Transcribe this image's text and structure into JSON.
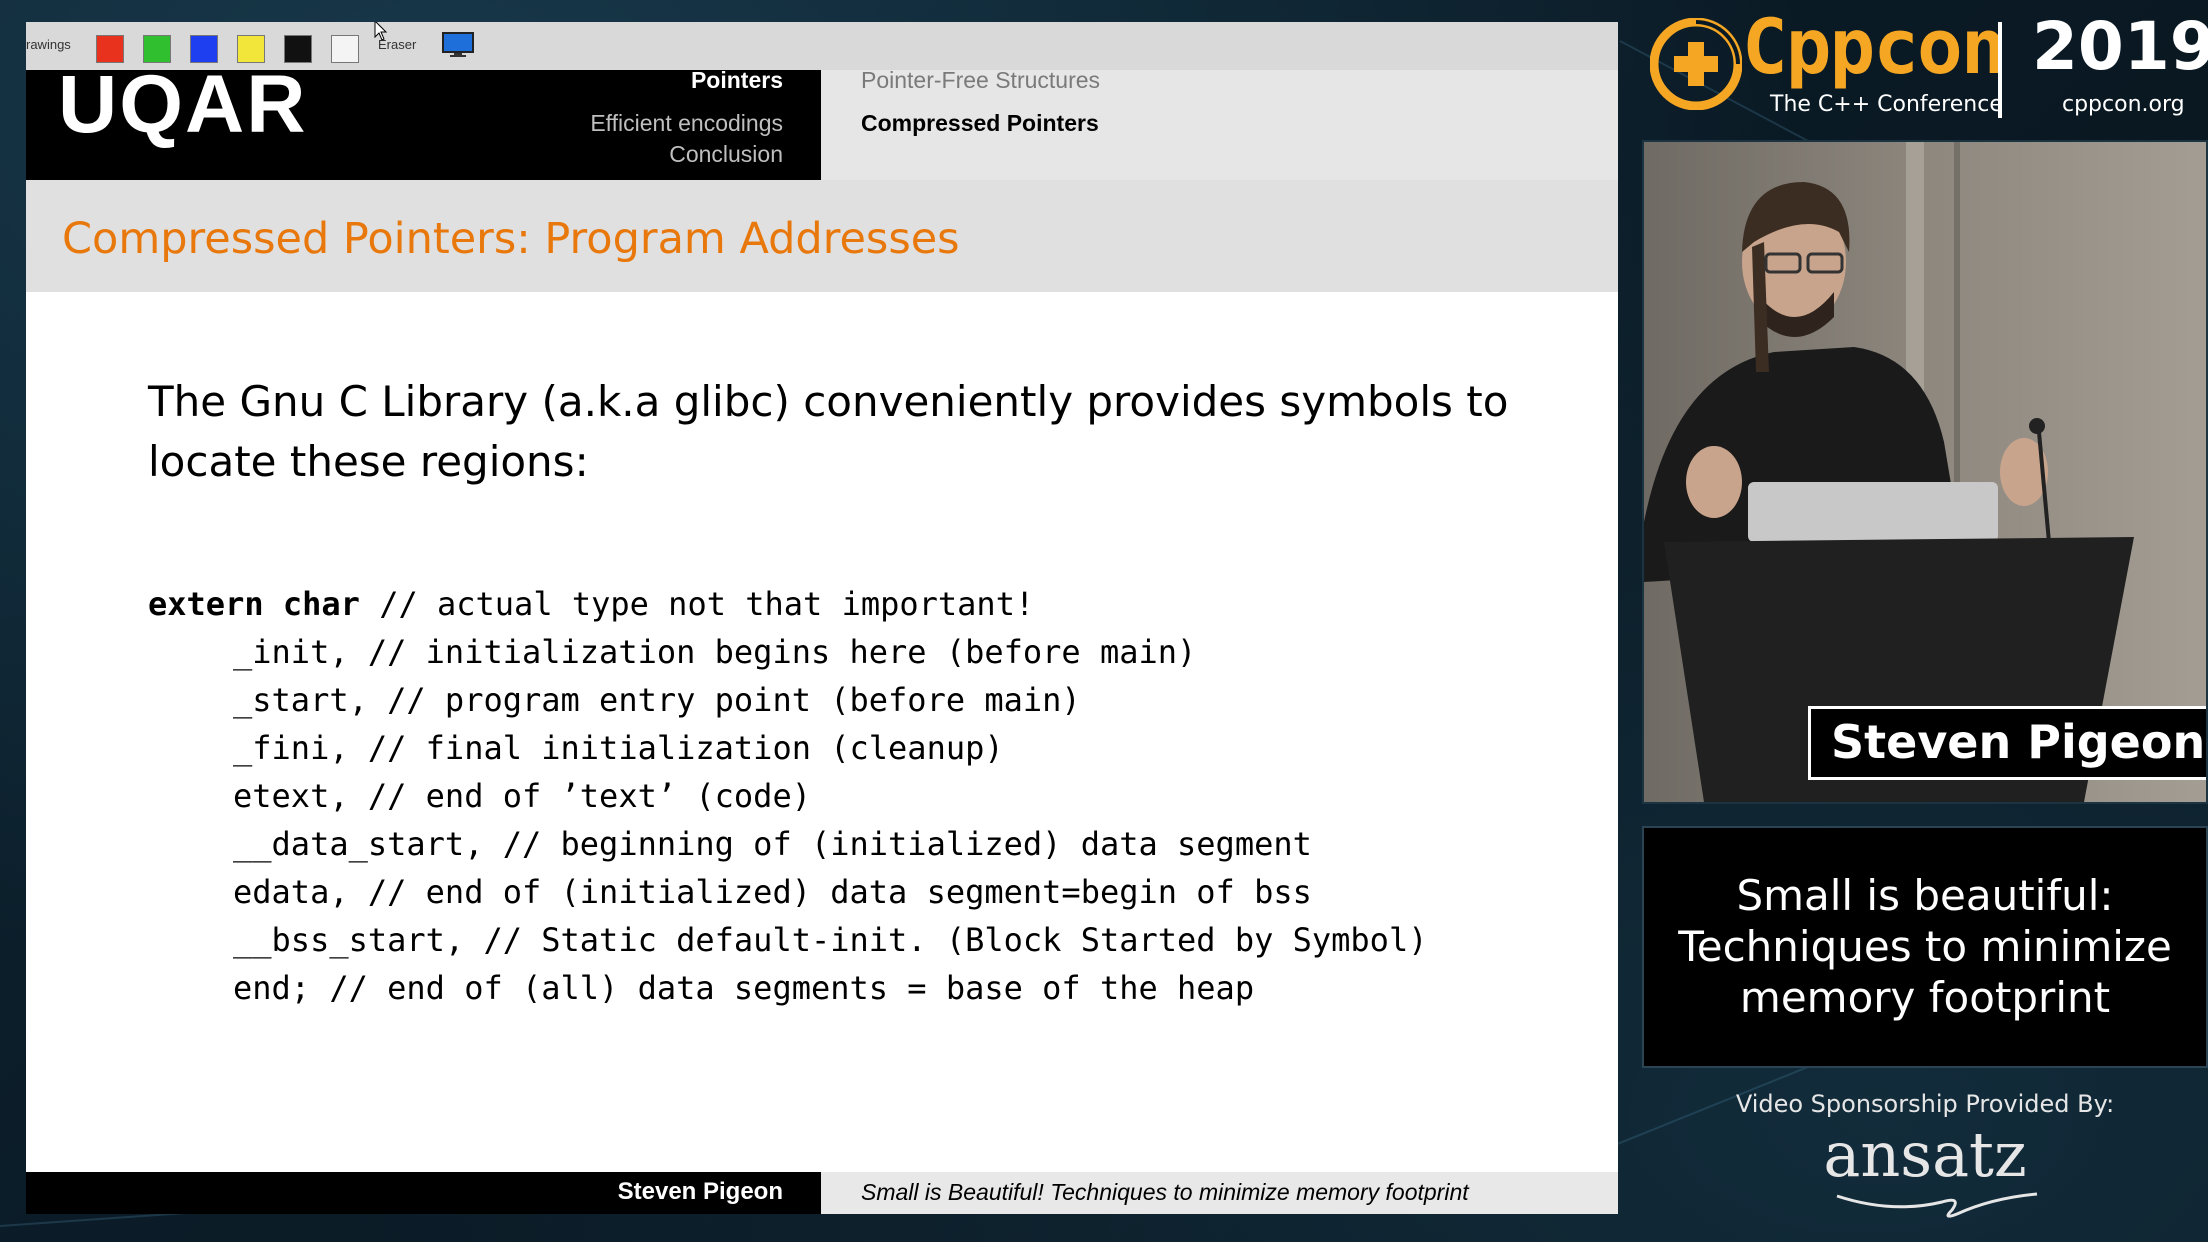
{
  "toolbar": {
    "drawings_label": "rawings",
    "eraser_label": "Eraser",
    "swatches": [
      "#e8321e",
      "#2fbf2f",
      "#1d3ff0",
      "#f2e63a",
      "#111111",
      "#f4f4f4"
    ]
  },
  "slide": {
    "logo": "UQAR",
    "nav_sections": [
      "Pointers",
      "Efficient encodings",
      "Conclusion"
    ],
    "nav_subsections": [
      "Pointer-Free Structures",
      "Compressed Pointers"
    ],
    "frame_title": "Compressed Pointers: Program Addresses",
    "intro": "The Gnu C Library (a.k.a glibc) conveniently provides symbols to locate these regions:",
    "code": {
      "keyword": "extern char",
      "first_comment": " // actual type not that important!",
      "lines": [
        "_init, // initialization begins here (before main)",
        "_start, // program entry point (before main)",
        "_fini, // final initialization (cleanup)",
        "etext, // end of ’text’ (code)",
        "__data_start, // beginning of (initialized) data segment",
        "edata, // end of (initialized) data segment=begin of bss",
        "__bss_start, // Static default-init. (Block Started by Symbol)",
        "end; // end of (all) data segments = base of the heap"
      ]
    },
    "footer_author": "Steven Pigeon",
    "footer_title": "Small is Beautiful! Techniques to minimize memory footprint"
  },
  "conference": {
    "name": "Cppcon",
    "tagline": "The C++ Conference",
    "year": "2019",
    "url": "cppcon.org",
    "brand_color": "#f5a623"
  },
  "speaker": {
    "name": "Steven Pigeon"
  },
  "talk": {
    "title_lines": [
      "Small is beautiful:",
      "Techniques to minimize",
      "memory footprint"
    ]
  },
  "sponsor": {
    "label": "Video Sponsorship Provided By:",
    "name": "ansatz"
  }
}
